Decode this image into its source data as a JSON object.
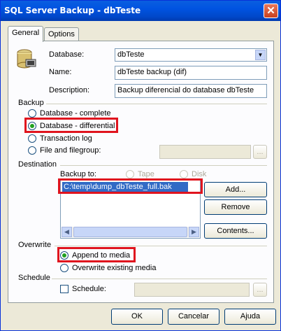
{
  "window": {
    "title": "SQL Server Backup - dbTeste",
    "close_glyph": "✕"
  },
  "tabs": [
    {
      "label": "General",
      "active": true
    },
    {
      "label": "Options",
      "active": false
    }
  ],
  "general": {
    "database_label": "Database:",
    "database_value": "dbTeste",
    "name_label": "Name:",
    "name_value": "dbTeste backup (dif)",
    "description_label": "Description:",
    "description_value": "Backup diferencial do database dbTeste"
  },
  "backup": {
    "group_label": "Backup",
    "options": [
      {
        "label": "Database - complete",
        "checked": false
      },
      {
        "label": "Database - differential",
        "checked": true
      },
      {
        "label": "Transaction log",
        "checked": false
      },
      {
        "label": "File and filegroup:",
        "checked": false
      }
    ],
    "browse_label": "..."
  },
  "destination": {
    "group_label": "Destination",
    "backup_to_label": "Backup to:",
    "tape_label": "Tape",
    "disk_label": "Disk",
    "items": [
      "C:\\temp\\dump_dbTeste_full.bak"
    ],
    "add_label": "Add...",
    "remove_label": "Remove",
    "contents_label": "Contents..."
  },
  "overwrite": {
    "group_label": "Overwrite",
    "append_label": "Append to media",
    "overwrite_label": "Overwrite existing media"
  },
  "schedule": {
    "group_label": "Schedule",
    "schedule_label": "Schedule:",
    "browse_label": "..."
  },
  "footer": {
    "ok_label": "OK",
    "cancel_label": "Cancelar",
    "help_label": "Ajuda"
  },
  "colors": {
    "highlight": "#e0141e",
    "selection": "#316ac5",
    "title_bar": "#0053e1"
  }
}
